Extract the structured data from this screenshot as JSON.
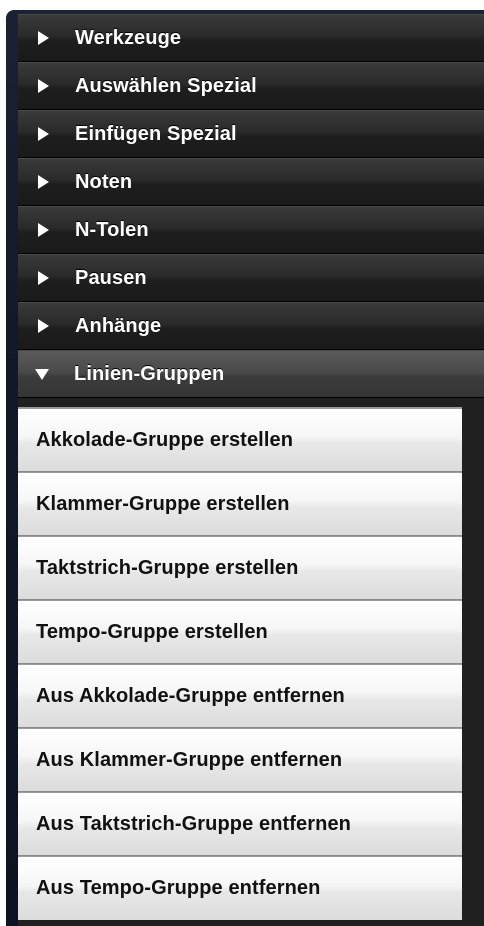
{
  "sections": [
    {
      "label": "Werkzeuge",
      "expanded": false,
      "icon": "triangle-right-icon"
    },
    {
      "label": "Auswählen Spezial",
      "expanded": false,
      "icon": "triangle-right-icon"
    },
    {
      "label": "Einfügen Spezial",
      "expanded": false,
      "icon": "triangle-right-icon"
    },
    {
      "label": "Noten",
      "expanded": false,
      "icon": "triangle-right-icon"
    },
    {
      "label": "N-Tolen",
      "expanded": false,
      "icon": "triangle-right-icon"
    },
    {
      "label": "Pausen",
      "expanded": false,
      "icon": "triangle-right-icon"
    },
    {
      "label": "Anhänge",
      "expanded": false,
      "icon": "triangle-right-icon"
    },
    {
      "label": "Linien-Gruppen",
      "expanded": true,
      "icon": "triangle-down-icon"
    }
  ],
  "items": [
    {
      "label": "Akkolade-Gruppe erstellen"
    },
    {
      "label": "Klammer-Gruppe erstellen"
    },
    {
      "label": "Taktstrich-Gruppe erstellen"
    },
    {
      "label": "Tempo-Gruppe erstellen"
    },
    {
      "label": "Aus Akkolade-Gruppe entfernen"
    },
    {
      "label": "Aus Klammer-Gruppe entfernen"
    },
    {
      "label": "Aus Taktstrich-Gruppe entfernen"
    },
    {
      "label": "Aus Tempo-Gruppe entfernen"
    }
  ]
}
